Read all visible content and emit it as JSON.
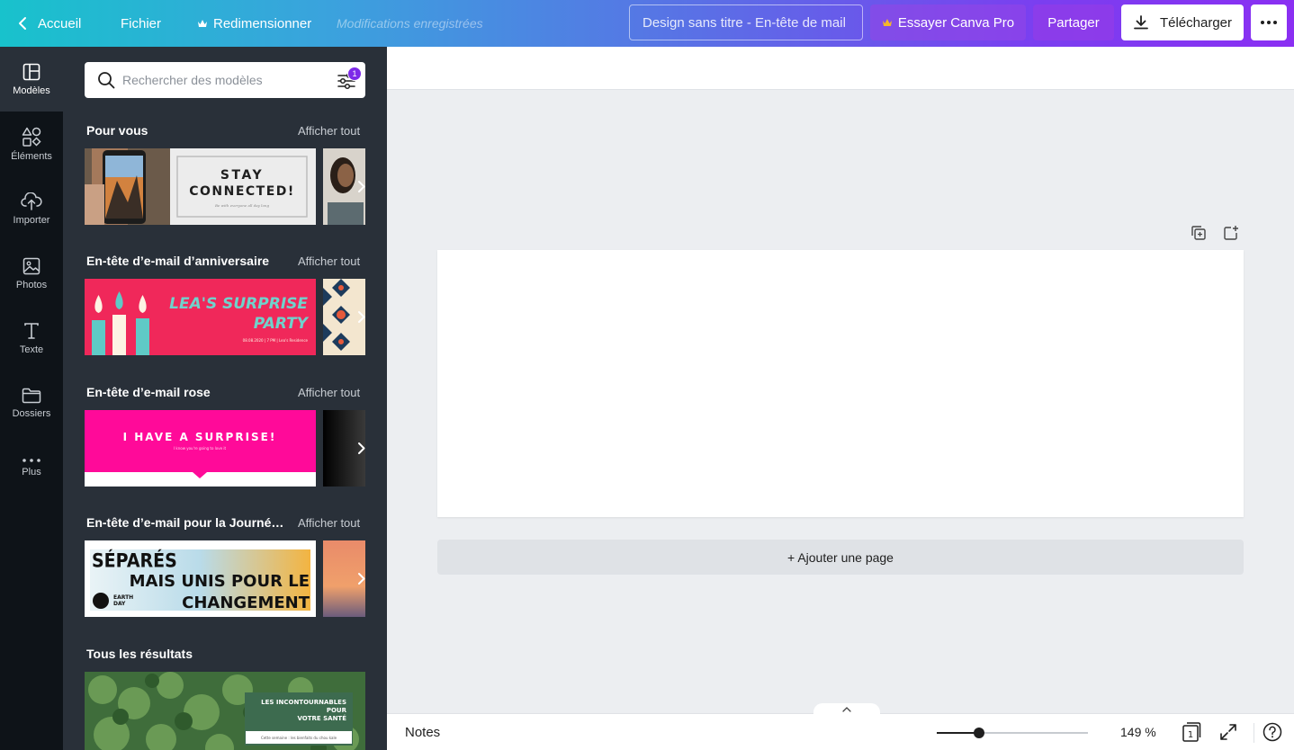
{
  "topbar": {
    "home_label": "Accueil",
    "file_label": "Fichier",
    "resize_label": "Redimensionner",
    "saved_status": "Modifications enregistrées",
    "design_title": "Design sans titre - En-tête de mail",
    "pro_label": "Essayer Canva Pro",
    "share_label": "Partager",
    "download_label": "Télécharger"
  },
  "rail": {
    "items": [
      {
        "label": "Modèles",
        "icon": "templates-icon"
      },
      {
        "label": "Éléments",
        "icon": "elements-icon"
      },
      {
        "label": "Importer",
        "icon": "upload-cloud-icon"
      },
      {
        "label": "Photos",
        "icon": "photo-icon"
      },
      {
        "label": "Texte",
        "icon": "text-icon"
      },
      {
        "label": "Dossiers",
        "icon": "folder-icon"
      },
      {
        "label": "Plus",
        "icon": "more-dots-icon"
      }
    ]
  },
  "panel": {
    "search_placeholder": "Rechercher des modèles",
    "filter_badge": "1",
    "see_all": "Afficher tout",
    "sections": [
      {
        "title": "Pour vous"
      },
      {
        "title": "En-tête d’e-mail d’anniversaire"
      },
      {
        "title": "En-tête d’e-mail rose"
      },
      {
        "title": "En-tête d’e-mail pour la Journée de la Terre"
      },
      {
        "title": "Tous les résultats"
      }
    ],
    "thumb_texts": {
      "stay": "STAY",
      "connected": "CONNECTED!",
      "stay_sub": "Be with everyone all day long",
      "lea1": "LEA'S SURPRISE",
      "lea2": "PARTY",
      "lea_sub": "08.08.2020 | 7 PM | Lea's Residence",
      "surprise": "I HAVE A SURPRISE!",
      "surprise_sub": "I know you're going to love it",
      "separes": "SÉPARÉS",
      "unis": "MAIS UNIS POUR LE",
      "changement": "CHANGEMENT",
      "earth": "EARTH",
      "day": "DAY",
      "health1": "LES INCONTOURNABLES",
      "health2": "POUR",
      "health3": "VOTRE SANTÉ",
      "health_sub": "Cette semaine : les bienfaits du chou kale"
    }
  },
  "canvas": {
    "add_page_label": "+ Ajouter une page"
  },
  "bottombar": {
    "notes_label": "Notes",
    "zoom_label": "149 %",
    "zoom_level": 0.28,
    "page_count": "1"
  }
}
